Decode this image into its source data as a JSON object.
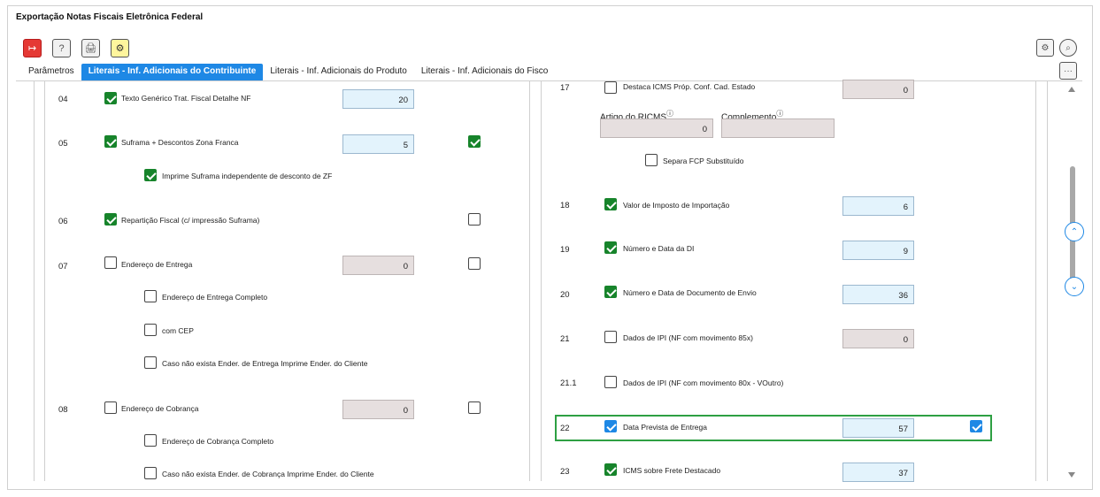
{
  "window": {
    "title": "Exportação Notas Fiscais Eletrônica Federal"
  },
  "toolbar": {
    "exit_icon": "↦",
    "help_icon": "?",
    "print_icon": "🖨",
    "settings_icon": "⚙",
    "gear_icon": "⚙",
    "search_icon": "⌕",
    "more_icon": "···"
  },
  "tabs": [
    {
      "label": "Parâmetros"
    },
    {
      "label": "Literais - Inf. Adicionais do Contribuinte"
    },
    {
      "label": "Literais - Inf. Adicionais do Produto"
    },
    {
      "label": "Literais - Inf. Adicionais do Fisco"
    }
  ],
  "left": {
    "r04": {
      "num": "04",
      "label": "Texto Genérico Trat. Fiscal Detalhe NF",
      "value": "20"
    },
    "r05": {
      "num": "05",
      "label": "Suframa + Descontos Zona Franca",
      "value": "5",
      "sub1": "Imprime Suframa independente de desconto de ZF"
    },
    "r06": {
      "num": "06",
      "label": "Repartição Fiscal (c/ impressão Suframa)"
    },
    "r07": {
      "num": "07",
      "label": "Endereço de Entrega",
      "value": "0",
      "sub1": "Endereço de Entrega Completo",
      "sub2": "com CEP",
      "sub3": "Caso não exista Ender. de Entrega Imprime Ender. do Cliente"
    },
    "r08": {
      "num": "08",
      "label": "Endereço de Cobrança",
      "value": "0",
      "sub1": "Endereço de Cobrança Completo",
      "sub2": "Caso não exista Ender. de Cobrança Imprime Ender. do Cliente"
    }
  },
  "right": {
    "r17": {
      "num": "17",
      "label": "Destaca ICMS Próp. Conf. Cad. Estado",
      "value": "0",
      "artigo_label": "Artigo do RICMS",
      "artigo_value": "0",
      "complemento_label": "Complemento",
      "complemento_value": "",
      "sub1": "Separa FCP Substituído"
    },
    "r18": {
      "num": "18",
      "label": "Valor de Imposto de Importação",
      "value": "6"
    },
    "r19": {
      "num": "19",
      "label": "Número e Data da DI",
      "value": "9"
    },
    "r20": {
      "num": "20",
      "label": "Número e Data de Documento de Envio",
      "value": "36"
    },
    "r21": {
      "num": "21",
      "label": "Dados de IPI (NF com movimento 85x)",
      "value": "0"
    },
    "r211": {
      "num": "21.1",
      "label": "Dados de IPI (NF com movimento 80x - VOutro)"
    },
    "r22": {
      "num": "22",
      "label": "Data Prevista de Entrega",
      "value": "57"
    },
    "r23": {
      "num": "23",
      "label": "ICMS sobre Frete Destacado",
      "value": "37"
    }
  },
  "colors": {
    "accent": "#1e88e5",
    "check": "#17842b",
    "highlight": "#2ea043"
  }
}
